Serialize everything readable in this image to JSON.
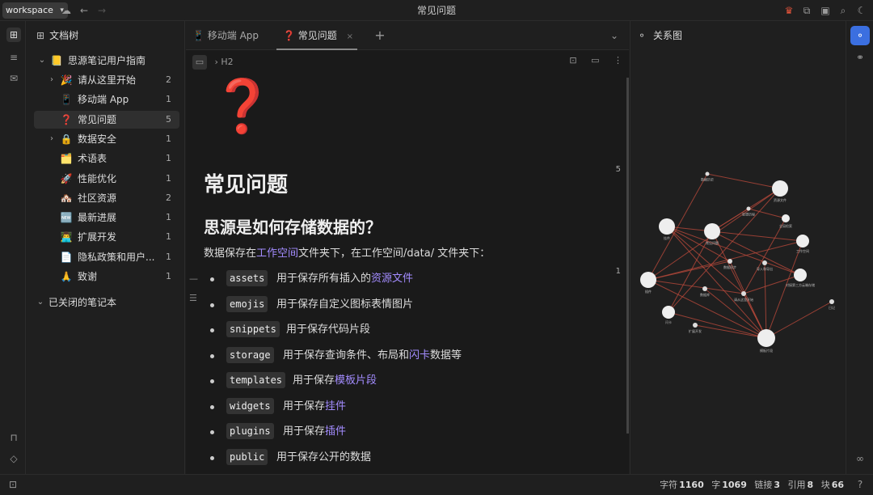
{
  "window": {
    "title": "常见问题",
    "workspace": "workspace"
  },
  "icons": {
    "cloud": "cloud-off-icon",
    "back": "arrow-left-icon",
    "forward": "arrow-right-icon",
    "crown": "crown-icon",
    "plugin": "puzzle-icon",
    "terminal": "terminal-icon",
    "search": "search-icon",
    "moon": "moon-icon"
  },
  "tree": {
    "title": "文档树",
    "notebook": {
      "name": "思源笔记用户指南"
    },
    "items": [
      {
        "emoji": "🎉",
        "label": "请从这里开始",
        "count": "2",
        "expandable": true
      },
      {
        "emoji": "📱",
        "label": "移动端 App",
        "count": "1",
        "expandable": false
      },
      {
        "emoji": "❓",
        "label": "常见问题",
        "count": "5",
        "expandable": false,
        "selected": true
      },
      {
        "emoji": "🔒",
        "label": "数据安全",
        "count": "1",
        "expandable": true
      },
      {
        "emoji": "🗂️",
        "label": "术语表",
        "count": "1",
        "expandable": false
      },
      {
        "emoji": "🚀",
        "label": "性能优化",
        "count": "1",
        "expandable": false
      },
      {
        "emoji": "🏘️",
        "label": "社区资源",
        "count": "2",
        "expandable": false
      },
      {
        "emoji": "🆕",
        "label": "最新进展",
        "count": "1",
        "expandable": false
      },
      {
        "emoji": "👨‍💻",
        "label": "扩展开发",
        "count": "1",
        "expandable": false
      },
      {
        "emoji": "📄",
        "label": "隐私政策和用户...",
        "count": "1",
        "expandable": false
      },
      {
        "emoji": "🙏",
        "label": "致谢",
        "count": "1",
        "expandable": false
      }
    ],
    "closed": "已关闭的笔记本"
  },
  "tabs": [
    {
      "emoji": "📱",
      "label": "移动端 App"
    },
    {
      "emoji": "❓",
      "label": "常见问题",
      "close": "×"
    }
  ],
  "editor": {
    "crumb_h": "H2",
    "big_icon": "❓",
    "h1": "常见问题",
    "h2": "思源是如何存储数据的？",
    "para_a": "数据保存在",
    "para_link": "工作空间",
    "para_b": "文件夹下，在工作空间/data/ 文件夹下：",
    "list": [
      {
        "code": "assets",
        "text": "用于保存所有插入的",
        "link": "资源文件"
      },
      {
        "code": "emojis",
        "text": "用于保存自定义图标表情图片",
        "link": ""
      },
      {
        "code": "snippets",
        "text": "用于保存代码片段",
        "link": ""
      },
      {
        "code": "storage",
        "text": "用于保存查询条件、布局和",
        "link": "闪卡",
        "after": "数据等"
      },
      {
        "code": "templates",
        "text": "用于保存",
        "link": "模板片段"
      },
      {
        "code": "widgets",
        "text": "用于保存",
        "link": "挂件"
      },
      {
        "code": "plugins",
        "text": "用于保存",
        "link": "插件"
      },
      {
        "code": "public",
        "text": "用于保存公开的数据",
        "link": ""
      }
    ],
    "margin_counts": [
      "5",
      "1"
    ]
  },
  "graph": {
    "title": "关系图",
    "nodes": [
      {
        "label": "数据历史",
        "r": 2.5,
        "c": "#ddd"
      },
      {
        "label": "资源文件",
        "r": 10,
        "c": "#eee"
      },
      {
        "label": "思想历程",
        "r": 2.5,
        "c": "#ddd"
      },
      {
        "label": "全局检索",
        "r": 5,
        "c": "#eee"
      },
      {
        "label": "挂件",
        "r": 10,
        "c": "#eee"
      },
      {
        "label": "常见问题",
        "r": 10,
        "c": "#eee"
      },
      {
        "label": "工作空间",
        "r": 8,
        "c": "#eee"
      },
      {
        "label": "数据同步",
        "r": 3,
        "c": "#ddd"
      },
      {
        "label": "导入和导出",
        "r": 3,
        "c": "#ddd"
      },
      {
        "label": "插件",
        "r": 10,
        "c": "#eee"
      },
      {
        "label": "对接第三方云端存储",
        "r": 8,
        "c": "#eee"
      },
      {
        "label": "数据库",
        "r": 3,
        "c": "#ddd"
      },
      {
        "label": "请从这里开始",
        "r": 3,
        "c": "#ddd"
      },
      {
        "label": "日记",
        "r": 3,
        "c": "#ddd"
      },
      {
        "label": "闪卡",
        "r": 8,
        "c": "#eee"
      },
      {
        "label": "扩展开发",
        "r": 3,
        "c": "#ddd"
      },
      {
        "label": "模板片段",
        "r": 11,
        "c": "#eee"
      }
    ],
    "edges": [
      [
        0,
        1
      ],
      [
        0,
        9
      ],
      [
        2,
        5
      ],
      [
        2,
        3
      ],
      [
        4,
        5
      ],
      [
        4,
        7
      ],
      [
        4,
        16
      ],
      [
        4,
        10
      ],
      [
        5,
        1
      ],
      [
        5,
        6
      ],
      [
        5,
        10
      ],
      [
        5,
        16
      ],
      [
        5,
        14
      ],
      [
        7,
        9
      ],
      [
        7,
        16
      ],
      [
        8,
        16
      ],
      [
        9,
        12
      ],
      [
        9,
        16
      ],
      [
        9,
        1
      ],
      [
        11,
        16
      ],
      [
        12,
        16
      ],
      [
        13,
        16
      ],
      [
        14,
        16
      ],
      [
        15,
        16
      ],
      [
        6,
        16
      ],
      [
        3,
        12
      ],
      [
        1,
        14
      ],
      [
        6,
        9
      ],
      [
        10,
        12
      ],
      [
        4,
        12
      ]
    ]
  },
  "status": {
    "chars_label": "字符",
    "chars": "1160",
    "words_label": "字",
    "words": "1069",
    "links_label": "链接",
    "links": "3",
    "refs_label": "引用",
    "refs": "8",
    "blocks_label": "块",
    "blocks": "66",
    "help": "?"
  }
}
